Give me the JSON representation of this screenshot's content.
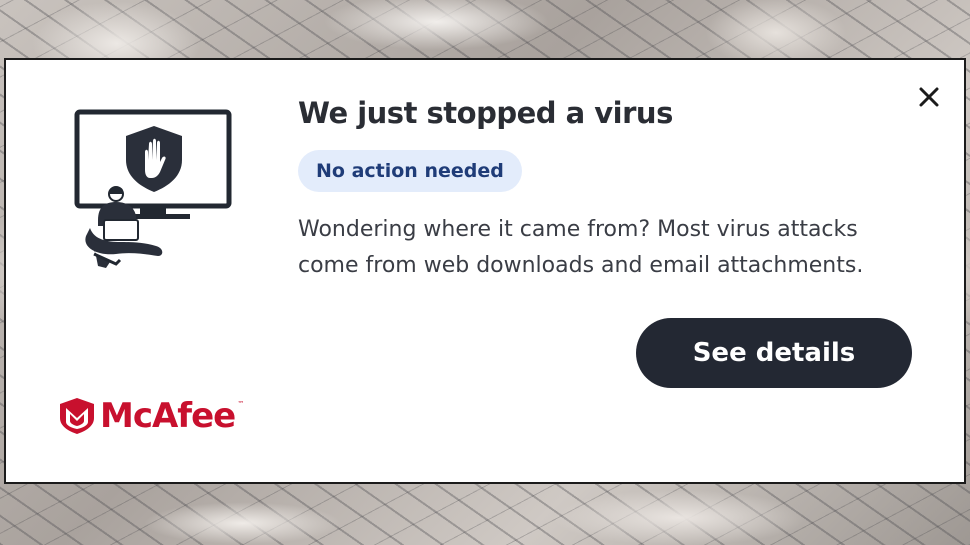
{
  "notification": {
    "title": "We just stopped a virus",
    "badge": "No action needed",
    "description": "Wondering where it came from? Most virus attacks come from web downloads and email attachments.",
    "cta_label": "See details",
    "close_icon": "close-icon",
    "illustration_icon": "protected-computer-illustration"
  },
  "brand": {
    "name": "McAfee",
    "trademark": "™",
    "logo_icon": "mcafee-shield-logo-icon",
    "color": "#c8102e"
  },
  "colors": {
    "title": "#2a2d34",
    "badge_bg": "#e3ecfb",
    "badge_text": "#1f3c78",
    "button_bg": "#232833",
    "button_text": "#ffffff"
  }
}
